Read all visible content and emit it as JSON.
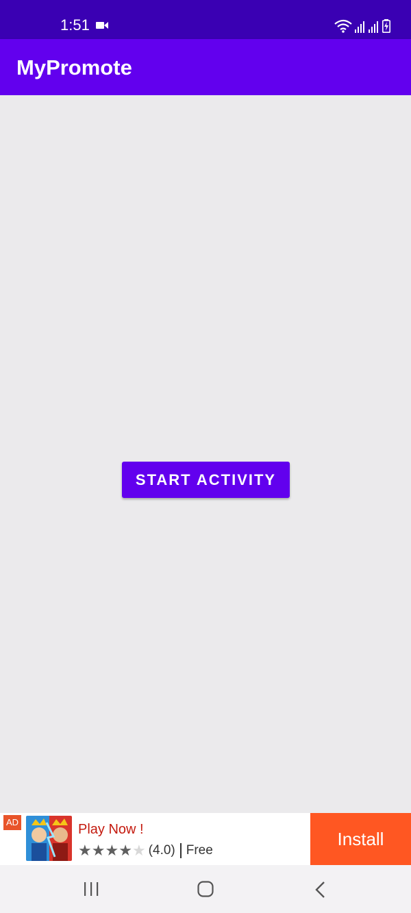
{
  "status_bar": {
    "time": "1:51",
    "icons": [
      "video-icon",
      "wifi-icon",
      "signal-icon",
      "signal-icon",
      "battery-charging-icon"
    ]
  },
  "app_bar": {
    "title": "MyPromote",
    "color": "#6200ee"
  },
  "main": {
    "start_button_label": "START ACTIVITY"
  },
  "ad": {
    "badge": "AD",
    "title": "Play Now !",
    "rating": "(4.0)",
    "rating_stars_filled": 4,
    "rating_stars_total": 5,
    "price": "Free",
    "install_label": "Install",
    "install_color": "#ff5722"
  },
  "nav_bar": {
    "icons": [
      "recent-apps-icon",
      "home-icon",
      "back-icon"
    ]
  },
  "colors": {
    "status_bar": "#3a00b3",
    "background": "#ebeaec"
  }
}
